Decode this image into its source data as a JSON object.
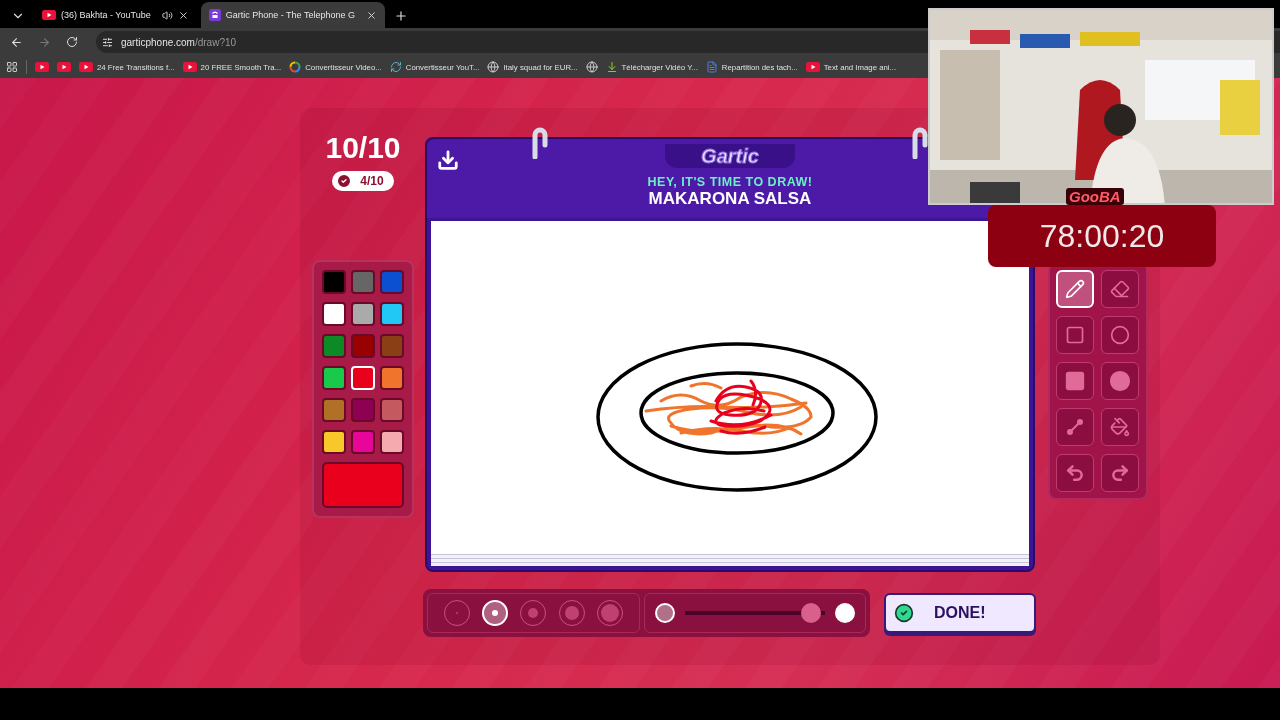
{
  "browser": {
    "tabs": [
      {
        "title": "(36) Bakhta - YouTube",
        "kind": "youtube",
        "audio": true,
        "selected": false
      },
      {
        "title": "Gartic Phone - The Telephone G",
        "kind": "phone",
        "audio": false,
        "selected": true
      }
    ],
    "forward_disabled": true,
    "url_host": "garticphone.com",
    "url_path": "/draw?10",
    "bookmarks": [
      {
        "kind": "youtube"
      },
      {
        "kind": "youtube"
      },
      {
        "kind": "youtube",
        "label": "24 Free Transitions f..."
      },
      {
        "kind": "youtube",
        "label": "20 FREE Smooth Tra..."
      },
      {
        "kind": "google",
        "label": "Convertisseur Video..."
      },
      {
        "kind": "converter",
        "label": "Convertisseur YouT..."
      },
      {
        "kind": "globe",
        "label": "Italy squad for EUR..."
      },
      {
        "kind": "globe"
      },
      {
        "kind": "download",
        "label": "Télécharger Vidéo Y..."
      },
      {
        "kind": "doc",
        "label": "Repartition des tach..."
      },
      {
        "kind": "youtube",
        "label": "Text and Image ani..."
      }
    ]
  },
  "round": "10/10",
  "done_count": "4/10",
  "header": {
    "logo": "Gartic",
    "subtitle": "HEY, IT'S TIME TO DRAW!",
    "prompt": "MAKARONA SALSA"
  },
  "palette": [
    {
      "color": "#000000",
      "selected": false
    },
    {
      "color": "#666666",
      "selected": false
    },
    {
      "color": "#0a50d0",
      "selected": false
    },
    {
      "color": "#ffffff",
      "selected": false
    },
    {
      "color": "#aaaaaa",
      "selected": false
    },
    {
      "color": "#22c8f5",
      "selected": false
    },
    {
      "color": "#0b8a25",
      "selected": false
    },
    {
      "color": "#990000",
      "selected": false
    },
    {
      "color": "#8b3f14",
      "selected": false
    },
    {
      "color": "#19c94a",
      "selected": false
    },
    {
      "color": "#e8001c",
      "selected": true
    },
    {
      "color": "#f0742c",
      "selected": false
    },
    {
      "color": "#b07026",
      "selected": false
    },
    {
      "color": "#8e0052",
      "selected": false
    },
    {
      "color": "#c45a60",
      "selected": false
    },
    {
      "color": "#f8c82a",
      "selected": false
    },
    {
      "color": "#e8059a",
      "selected": false
    },
    {
      "color": "#f5aab0",
      "selected": false
    }
  ],
  "tools": [
    {
      "kind": "pencil",
      "selected": true
    },
    {
      "kind": "eraser",
      "selected": false
    },
    {
      "kind": "rect",
      "selected": false
    },
    {
      "kind": "ellipse",
      "selected": false
    },
    {
      "kind": "rect_fill",
      "selected": false
    },
    {
      "kind": "ellipse_fill",
      "selected": false
    },
    {
      "kind": "line",
      "selected": false
    },
    {
      "kind": "bucket",
      "selected": false
    },
    {
      "kind": "undo",
      "selected": false
    },
    {
      "kind": "redo",
      "selected": false
    }
  ],
  "sizes": [
    {
      "selected": false
    },
    {
      "selected": true
    },
    {
      "selected": false
    },
    {
      "selected": false
    },
    {
      "selected": false
    }
  ],
  "opacity": {
    "level": 0.9
  },
  "done_button": "DONE!",
  "streamer": {
    "name": "GooBA",
    "timer": "78:00:20"
  }
}
